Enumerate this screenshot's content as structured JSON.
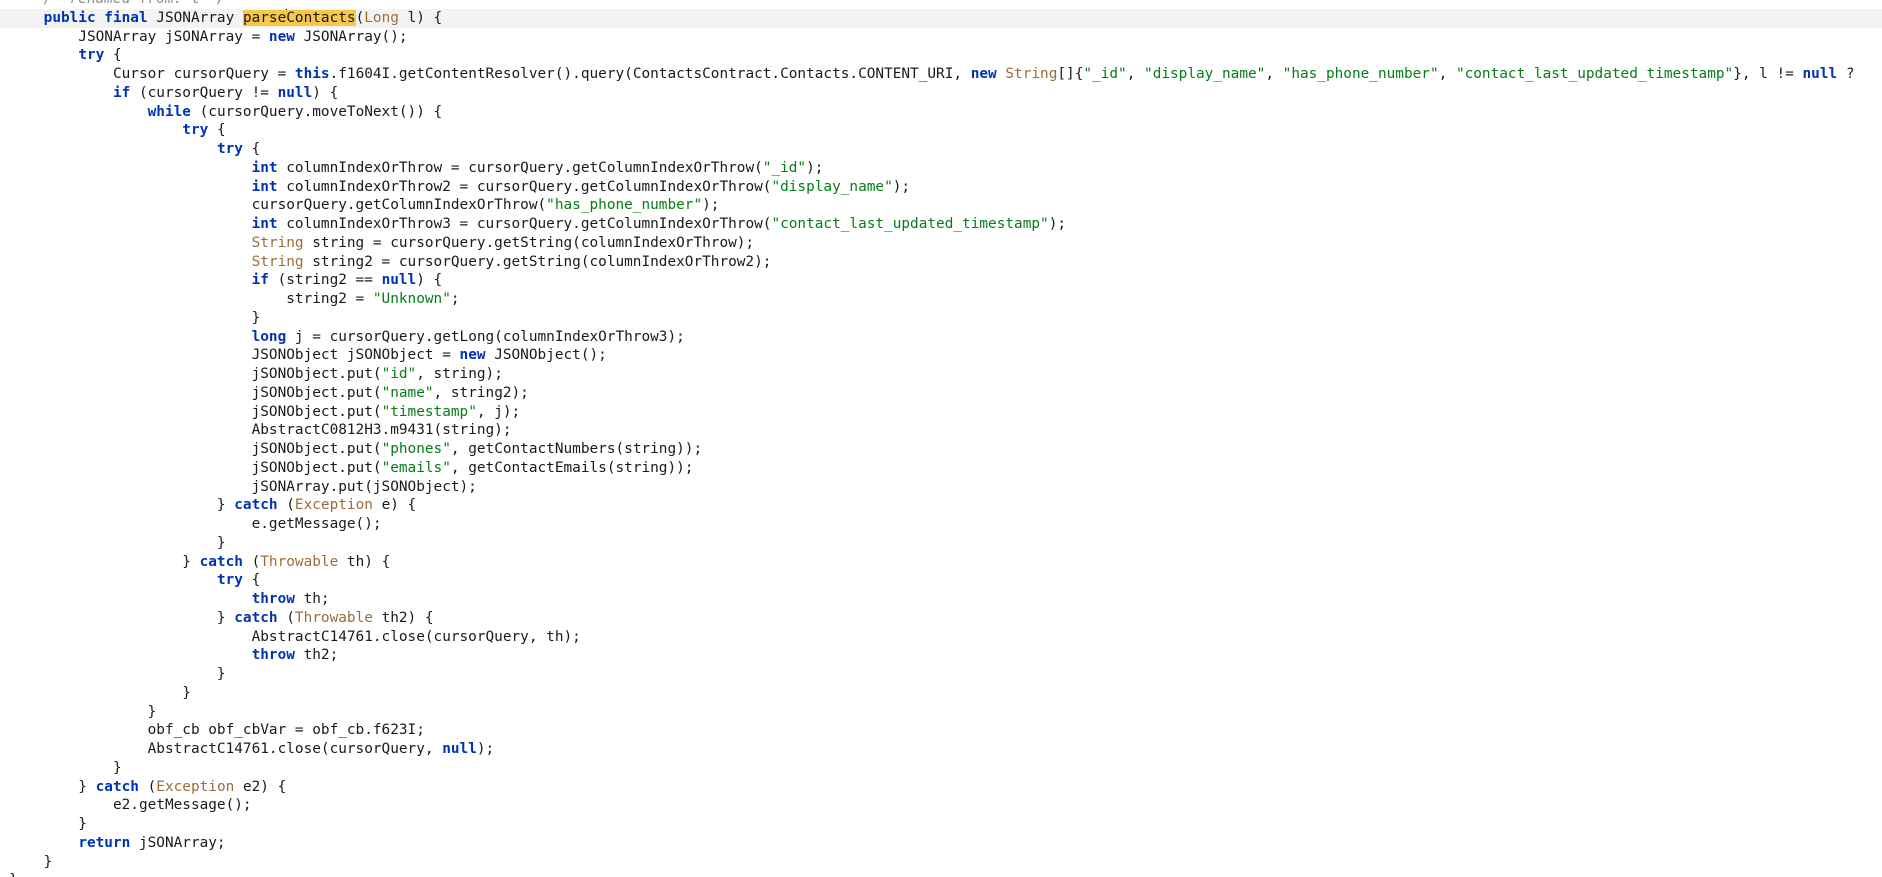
{
  "editor": {
    "highlight_color": "#f7c74a",
    "keyword_color": "#0033b3",
    "string_color": "#067d17",
    "type_color": "#9a6e3a",
    "lines": [
      [
        {
          "c": "cm",
          "t": "    /* renamed from: l */"
        }
      ],
      [
        {
          "c": "",
          "t": "    "
        },
        {
          "c": "kw",
          "t": "public final"
        },
        {
          "c": "",
          "t": " JSONArray "
        },
        {
          "c": "hl",
          "t": "parse"
        },
        {
          "c": "caret",
          "t": ""
        },
        {
          "c": "hl",
          "t": "Contacts"
        },
        {
          "c": "",
          "t": "("
        },
        {
          "c": "ty",
          "t": "Long"
        },
        {
          "c": "",
          "t": " l) {"
        }
      ],
      [
        {
          "c": "",
          "t": "        JSONArray jSONArray = "
        },
        {
          "c": "kw",
          "t": "new"
        },
        {
          "c": "",
          "t": " JSONArray();"
        }
      ],
      [
        {
          "c": "",
          "t": "        "
        },
        {
          "c": "kw",
          "t": "try"
        },
        {
          "c": "",
          "t": " {"
        }
      ],
      [
        {
          "c": "",
          "t": "            Cursor cursorQuery = "
        },
        {
          "c": "kw",
          "t": "this"
        },
        {
          "c": "",
          "t": ".f1604I.getContentResolver().query(ContactsContract.Contacts.CONTENT_URI, "
        },
        {
          "c": "kw",
          "t": "new"
        },
        {
          "c": "",
          "t": " "
        },
        {
          "c": "ty",
          "t": "String"
        },
        {
          "c": "",
          "t": "[]{"
        },
        {
          "c": "str",
          "t": "\"_id\""
        },
        {
          "c": "",
          "t": ", "
        },
        {
          "c": "str",
          "t": "\"display_name\""
        },
        {
          "c": "",
          "t": ", "
        },
        {
          "c": "str",
          "t": "\"has_phone_number\""
        },
        {
          "c": "",
          "t": ", "
        },
        {
          "c": "str",
          "t": "\"contact_last_updated_timestamp\""
        },
        {
          "c": "",
          "t": "}, l != "
        },
        {
          "c": "kw",
          "t": "null"
        },
        {
          "c": "",
          "t": " ?"
        }
      ],
      [
        {
          "c": "",
          "t": "            "
        },
        {
          "c": "kw",
          "t": "if"
        },
        {
          "c": "",
          "t": " (cursorQuery != "
        },
        {
          "c": "kw",
          "t": "null"
        },
        {
          "c": "",
          "t": ") {"
        }
      ],
      [
        {
          "c": "",
          "t": "                "
        },
        {
          "c": "kw",
          "t": "while"
        },
        {
          "c": "",
          "t": " (cursorQuery.moveToNext()) {"
        }
      ],
      [
        {
          "c": "",
          "t": "                    "
        },
        {
          "c": "kw",
          "t": "try"
        },
        {
          "c": "",
          "t": " {"
        }
      ],
      [
        {
          "c": "",
          "t": "                        "
        },
        {
          "c": "kw",
          "t": "try"
        },
        {
          "c": "",
          "t": " {"
        }
      ],
      [
        {
          "c": "",
          "t": "                            "
        },
        {
          "c": "kw",
          "t": "int"
        },
        {
          "c": "",
          "t": " columnIndexOrThrow = cursorQuery.getColumnIndexOrThrow("
        },
        {
          "c": "str",
          "t": "\"_id\""
        },
        {
          "c": "",
          "t": ");"
        }
      ],
      [
        {
          "c": "",
          "t": "                            "
        },
        {
          "c": "kw",
          "t": "int"
        },
        {
          "c": "",
          "t": " columnIndexOrThrow2 = cursorQuery.getColumnIndexOrThrow("
        },
        {
          "c": "str",
          "t": "\"display_name\""
        },
        {
          "c": "",
          "t": ");"
        }
      ],
      [
        {
          "c": "",
          "t": "                            cursorQuery.getColumnIndexOrThrow("
        },
        {
          "c": "str",
          "t": "\"has_phone_number\""
        },
        {
          "c": "",
          "t": ");"
        }
      ],
      [
        {
          "c": "",
          "t": "                            "
        },
        {
          "c": "kw",
          "t": "int"
        },
        {
          "c": "",
          "t": " columnIndexOrThrow3 = cursorQuery.getColumnIndexOrThrow("
        },
        {
          "c": "str",
          "t": "\"contact_last_updated_timestamp\""
        },
        {
          "c": "",
          "t": ");"
        }
      ],
      [
        {
          "c": "",
          "t": "                            "
        },
        {
          "c": "ty",
          "t": "String"
        },
        {
          "c": "",
          "t": " string = cursorQuery.getString(columnIndexOrThrow);"
        }
      ],
      [
        {
          "c": "",
          "t": "                            "
        },
        {
          "c": "ty",
          "t": "String"
        },
        {
          "c": "",
          "t": " string2 = cursorQuery.getString(columnIndexOrThrow2);"
        }
      ],
      [
        {
          "c": "",
          "t": "                            "
        },
        {
          "c": "kw",
          "t": "if"
        },
        {
          "c": "",
          "t": " (string2 == "
        },
        {
          "c": "kw",
          "t": "null"
        },
        {
          "c": "",
          "t": ") {"
        }
      ],
      [
        {
          "c": "",
          "t": "                                string2 = "
        },
        {
          "c": "str",
          "t": "\"Unknown\""
        },
        {
          "c": "",
          "t": ";"
        }
      ],
      [
        {
          "c": "",
          "t": "                            }"
        }
      ],
      [
        {
          "c": "",
          "t": "                            "
        },
        {
          "c": "kw",
          "t": "long"
        },
        {
          "c": "",
          "t": " j = cursorQuery.getLong(columnIndexOrThrow3);"
        }
      ],
      [
        {
          "c": "",
          "t": "                            JSONObject jSONObject = "
        },
        {
          "c": "kw",
          "t": "new"
        },
        {
          "c": "",
          "t": " JSONObject();"
        }
      ],
      [
        {
          "c": "",
          "t": "                            jSONObject.put("
        },
        {
          "c": "str",
          "t": "\"id\""
        },
        {
          "c": "",
          "t": ", string);"
        }
      ],
      [
        {
          "c": "",
          "t": "                            jSONObject.put("
        },
        {
          "c": "str",
          "t": "\"name\""
        },
        {
          "c": "",
          "t": ", string2);"
        }
      ],
      [
        {
          "c": "",
          "t": "                            jSONObject.put("
        },
        {
          "c": "str",
          "t": "\"timestamp\""
        },
        {
          "c": "",
          "t": ", j);"
        }
      ],
      [
        {
          "c": "",
          "t": "                            AbstractC0812H3.m9431(string);"
        }
      ],
      [
        {
          "c": "",
          "t": "                            jSONObject.put("
        },
        {
          "c": "str",
          "t": "\"phones\""
        },
        {
          "c": "",
          "t": ", getContactNumbers(string));"
        }
      ],
      [
        {
          "c": "",
          "t": "                            jSONObject.put("
        },
        {
          "c": "str",
          "t": "\"emails\""
        },
        {
          "c": "",
          "t": ", getContactEmails(string));"
        }
      ],
      [
        {
          "c": "",
          "t": "                            jSONArray.put(jSONObject);"
        }
      ],
      [
        {
          "c": "",
          "t": "                        } "
        },
        {
          "c": "kw",
          "t": "catch"
        },
        {
          "c": "",
          "t": " ("
        },
        {
          "c": "ty",
          "t": "Exception"
        },
        {
          "c": "",
          "t": " e) {"
        }
      ],
      [
        {
          "c": "",
          "t": "                            e.getMessage();"
        }
      ],
      [
        {
          "c": "",
          "t": "                        }"
        }
      ],
      [
        {
          "c": "",
          "t": "                    } "
        },
        {
          "c": "kw",
          "t": "catch"
        },
        {
          "c": "",
          "t": " ("
        },
        {
          "c": "ty",
          "t": "Throwable"
        },
        {
          "c": "",
          "t": " th) {"
        }
      ],
      [
        {
          "c": "",
          "t": "                        "
        },
        {
          "c": "kw",
          "t": "try"
        },
        {
          "c": "",
          "t": " {"
        }
      ],
      [
        {
          "c": "",
          "t": "                            "
        },
        {
          "c": "kw",
          "t": "throw"
        },
        {
          "c": "",
          "t": " th;"
        }
      ],
      [
        {
          "c": "",
          "t": "                        } "
        },
        {
          "c": "kw",
          "t": "catch"
        },
        {
          "c": "",
          "t": " ("
        },
        {
          "c": "ty",
          "t": "Throwable"
        },
        {
          "c": "",
          "t": " th2) {"
        }
      ],
      [
        {
          "c": "",
          "t": "                            AbstractC14761.close(cursorQuery, th);"
        }
      ],
      [
        {
          "c": "",
          "t": "                            "
        },
        {
          "c": "kw",
          "t": "throw"
        },
        {
          "c": "",
          "t": " th2;"
        }
      ],
      [
        {
          "c": "",
          "t": "                        }"
        }
      ],
      [
        {
          "c": "",
          "t": "                    }"
        }
      ],
      [
        {
          "c": "",
          "t": "                }"
        }
      ],
      [
        {
          "c": "",
          "t": "                obf_cb obf_cbVar = obf_cb.f623I;"
        }
      ],
      [
        {
          "c": "",
          "t": "                AbstractC14761.close(cursorQuery, "
        },
        {
          "c": "kw",
          "t": "null"
        },
        {
          "c": "",
          "t": ");"
        }
      ],
      [
        {
          "c": "",
          "t": "            }"
        }
      ],
      [
        {
          "c": "",
          "t": "        } "
        },
        {
          "c": "kw",
          "t": "catch"
        },
        {
          "c": "",
          "t": " ("
        },
        {
          "c": "ty",
          "t": "Exception"
        },
        {
          "c": "",
          "t": " e2) {"
        }
      ],
      [
        {
          "c": "",
          "t": "            e2.getMessage();"
        }
      ],
      [
        {
          "c": "",
          "t": "        }"
        }
      ],
      [
        {
          "c": "",
          "t": "        "
        },
        {
          "c": "kw",
          "t": "return"
        },
        {
          "c": "",
          "t": " jSONArray;"
        }
      ],
      [
        {
          "c": "",
          "t": "    }"
        }
      ],
      [
        {
          "c": "",
          "t": "}"
        }
      ]
    ]
  }
}
